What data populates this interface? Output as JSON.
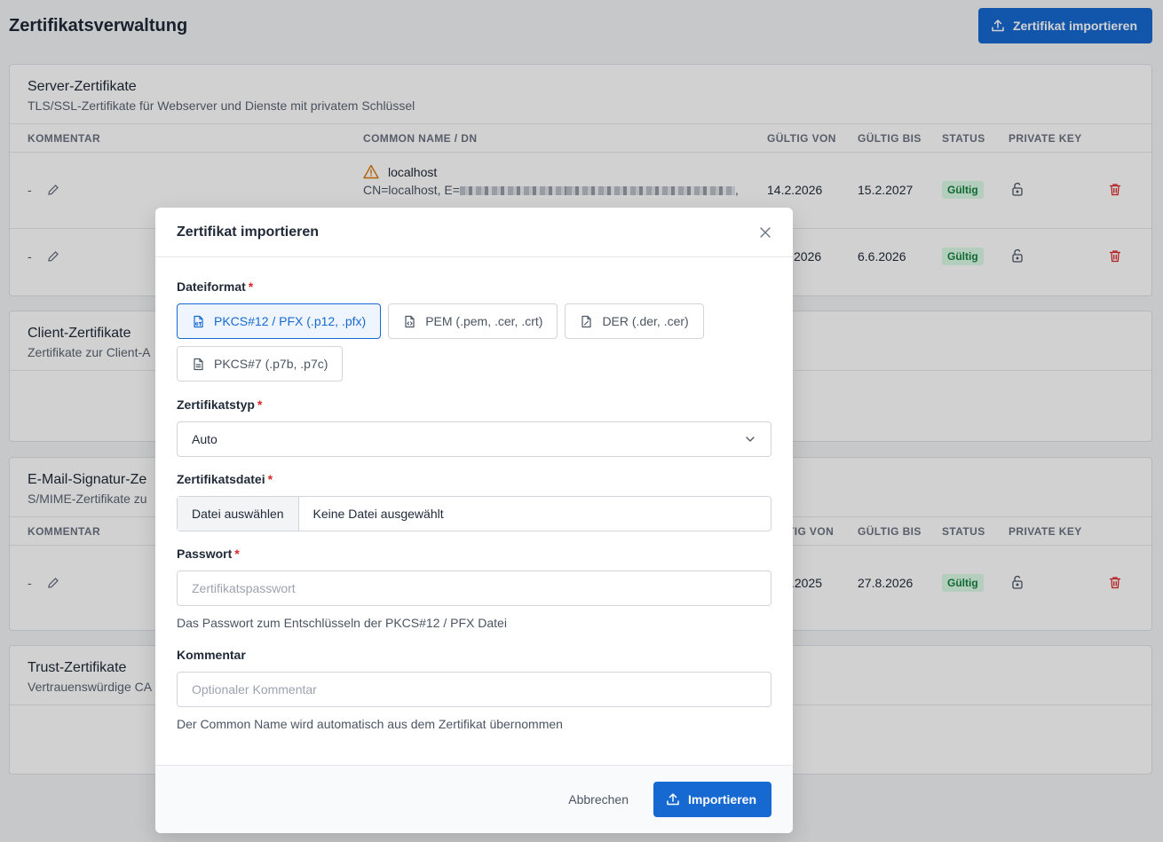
{
  "page": {
    "title": "Zertifikatsverwaltung",
    "import_button": "Zertifikat importieren"
  },
  "colors": {
    "accent": "#1769d2",
    "valid_badge_bg": "#dcfce7",
    "valid_badge_text": "#15803d",
    "danger": "#dc2626",
    "warning": "#d97706"
  },
  "icons": {
    "upload": "upload-icon",
    "edit": "pencil-icon",
    "lock": "lock-open-icon",
    "delete": "trash-icon",
    "warning": "warning-triangle-icon",
    "close": "close-icon",
    "chevron": "chevron-down-icon",
    "file": "file-icon"
  },
  "columns": [
    "KOMMENTAR",
    "COMMON NAME / DN",
    "GÜLTIG VON",
    "GÜLTIG BIS",
    "STATUS",
    "PRIVATE KEY"
  ],
  "server": {
    "title": "Server-Zertifikate",
    "subtitle": "TLS/SSL-Zertifikate für Webserver und Dienste mit privatem Schlüssel",
    "rows": [
      {
        "comment": "-",
        "cn": "localhost",
        "dn_prefix": "CN=localhost, E=",
        "dn_suffix": ",",
        "valid_from": "14.2.2026",
        "valid_to": "15.2.2027",
        "status": "Gültig"
      },
      {
        "comment": "-",
        "valid_from_visible": "2026",
        "valid_to": "6.6.2026",
        "status": "Gültig"
      }
    ]
  },
  "client": {
    "title": "Client-Zertifikate",
    "subtitle_visible": "Zertifikate zur Client-A"
  },
  "email": {
    "title_visible": "E-Mail-Signatur-Ze",
    "subtitle_visible": "S/MIME-Zertifikate zu",
    "columns_visible": [
      "KOMMENTAR",
      "TIG VON",
      "GÜLTIG BIS",
      "STATUS",
      "PRIVATE KEY"
    ],
    "rows": [
      {
        "comment": "-",
        "valid_from_visible": ".2025",
        "valid_to": "27.8.2026",
        "status": "Gültig"
      }
    ]
  },
  "trust": {
    "title": "Trust-Zertifikate",
    "subtitle_visible": "Vertrauenswürdige CA"
  },
  "modal": {
    "title": "Zertifikat importieren",
    "format_label": "Dateiformat",
    "formats": [
      "PKCS#12 / PFX (.p12, .pfx)",
      "PEM (.pem, .cer, .crt)",
      "DER (.der, .cer)",
      "PKCS#7 (.p7b, .p7c)"
    ],
    "type_label": "Zertifikatstyp",
    "type_value": "Auto",
    "file_label": "Zertifikatsdatei",
    "file_button": "Datei auswählen",
    "file_value": "Keine Datei ausgewählt",
    "password_label": "Passwort",
    "password_placeholder": "Zertifikatspasswort",
    "password_help": "Das Passwort zum Entschlüsseln der PKCS#12 / PFX Datei",
    "comment_label": "Kommentar",
    "comment_placeholder": "Optionaler Kommentar",
    "comment_help": "Der Common Name wird automatisch aus dem Zertifikat übernommen",
    "cancel": "Abbrechen",
    "submit": "Importieren",
    "required_mark": "*"
  }
}
